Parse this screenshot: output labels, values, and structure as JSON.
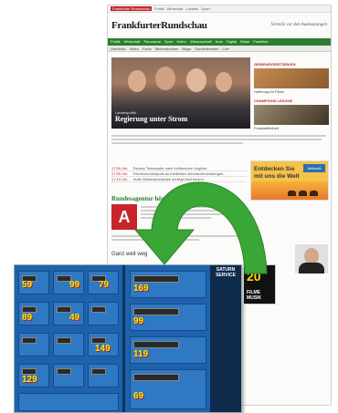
{
  "site": {
    "topbar": [
      "Frankfurter Rundschau",
      "Politik",
      "Wirtschaft",
      "Lokales",
      "Sport"
    ],
    "logo": "FrankfurterRundschau",
    "promo": "Vorteile vor den Ausbeutungen",
    "nav": [
      "Politik",
      "Wirtschaft",
      "Panorama",
      "Sport",
      "Kultur",
      "Wissenschaft",
      "Auto",
      "Digital",
      "Reise",
      "Frankfurt"
    ],
    "subnav": [
      "Überblick",
      "Video",
      "Fotos",
      "Bilderstrecken",
      "Blogs",
      "Sonderthemen",
      "Live"
    ],
    "hero_kicker": "Landespolitik",
    "hero_headline": "Regierung unter Strom",
    "side_items": [
      {
        "title": "GEISEHRVERSTÄRKEN",
        "caption": "Hoffnung für Pkws",
        "color": "#c58b4f"
      },
      {
        "title": "CHAMPIONS LEAGUE",
        "caption": "Fussballfreiheit",
        "color": "#6b5a42"
      }
    ],
    "ticker": [
      {
        "time": "17:55 Uhr",
        "text": "Paukes Todesopfer nach Heftschnee Unglück"
      },
      {
        "time": "17:30 Uhr",
        "text": "Friedensnobelpreis an friedlichen Arbeitsverhandlungen"
      },
      {
        "time": "17:10 Uhr",
        "text": "Huttu Winterarbeitslose schlägt Wall kommt"
      }
    ],
    "ad_text": "Entdecken Sie mit uns die Welt",
    "ad_logo": "Weltweit",
    "headline2": "Rundesagentur hört bereits",
    "ad_letter": "A",
    "gansweb": "Ganz weit weg"
  },
  "flyer": {
    "prices": [
      "59",
      "99",
      "79",
      "89",
      "49",
      "149",
      "129",
      "169",
      "99",
      "119",
      "69"
    ],
    "side_title": "SATURN SERVICE"
  },
  "inset": {
    "number": "20",
    "label": "FILME MUSIK"
  },
  "colors": {
    "arrow": "#3aa635",
    "flyer_blue": "#1e62ad",
    "accent_red": "#c8242b"
  }
}
